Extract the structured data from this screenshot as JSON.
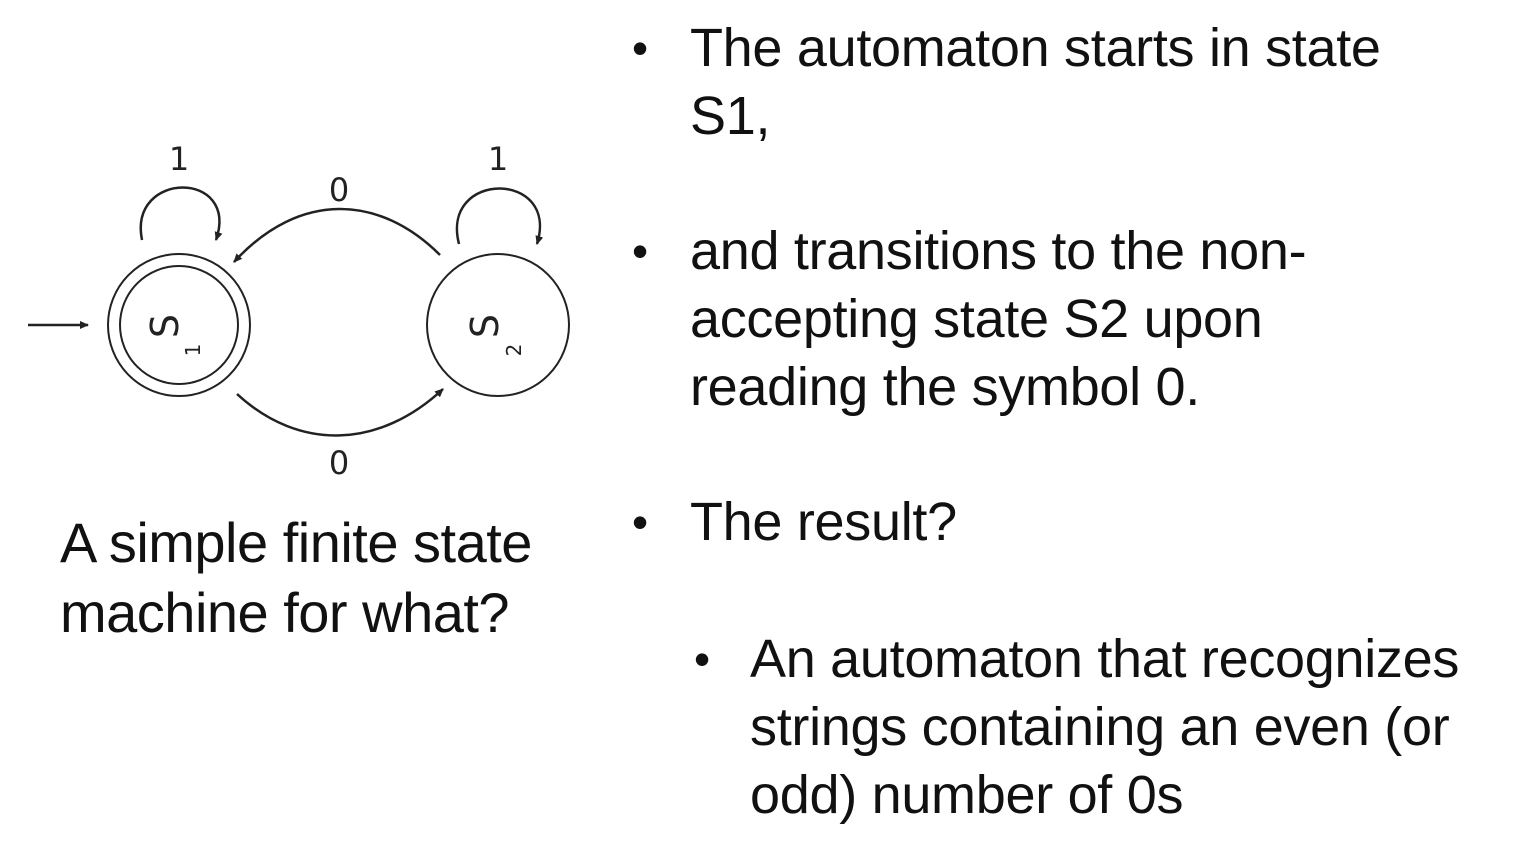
{
  "diagram": {
    "states": [
      {
        "id": "s1",
        "label": "S",
        "sub": "1",
        "accepting": true,
        "start": true
      },
      {
        "id": "s2",
        "label": "S",
        "sub": "2",
        "accepting": false,
        "start": false
      }
    ],
    "transitions": [
      {
        "from": "s1",
        "to": "s1",
        "symbol": "1"
      },
      {
        "from": "s2",
        "to": "s2",
        "symbol": "1"
      },
      {
        "from": "s2",
        "to": "s1",
        "symbol": "0"
      },
      {
        "from": "s1",
        "to": "s2",
        "symbol": "0"
      }
    ]
  },
  "caption": {
    "line1": "A simple finite state",
    "line2": "machine for what?"
  },
  "bullets": [
    {
      "bullet": "•",
      "lines": [
        "The automaton starts in state",
        "S1,"
      ]
    },
    {
      "bullet": "•",
      "lines": [
        "and transitions to the non-",
        "accepting state S2 upon",
        "reading the symbol 0."
      ]
    },
    {
      "bullet": "•",
      "lines": [
        "The result?"
      ]
    },
    {
      "bullet": "•",
      "lines": [
        "An automaton that recognizes",
        "strings containing an even (or",
        "odd) number of 0s"
      ]
    }
  ]
}
